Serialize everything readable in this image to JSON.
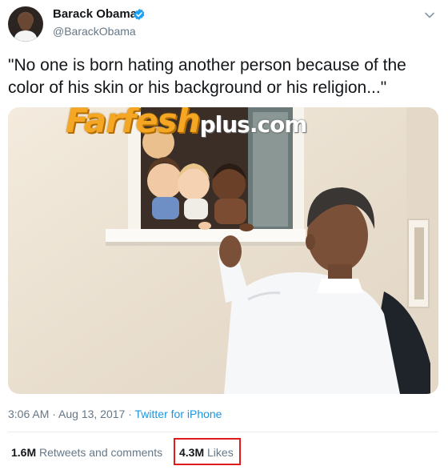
{
  "author": {
    "name": "Barack Obama",
    "handle": "@BarackObama"
  },
  "tweet": {
    "text": "\"No one is born hating another person because of the color of his skin or his background or his religion...\""
  },
  "watermark": {
    "brand": "Farfesh",
    "suffix": "plus.com"
  },
  "meta": {
    "timestamp": "3:06 AM · Aug 13, 2017 · ",
    "source": "Twitter for iPhone"
  },
  "stats": {
    "retweets_count": "1.6M",
    "retweets_label": " Retweets and comments",
    "likes_count": "4.3M",
    "likes_label": " Likes"
  },
  "colors": {
    "link": "#1b95e0",
    "verified": "#1da1f2",
    "highlight_box": "#e01b1b",
    "watermark_orange": "#f5a623"
  },
  "icons": [
    "verified-badge-icon",
    "chevron-down-icon"
  ]
}
